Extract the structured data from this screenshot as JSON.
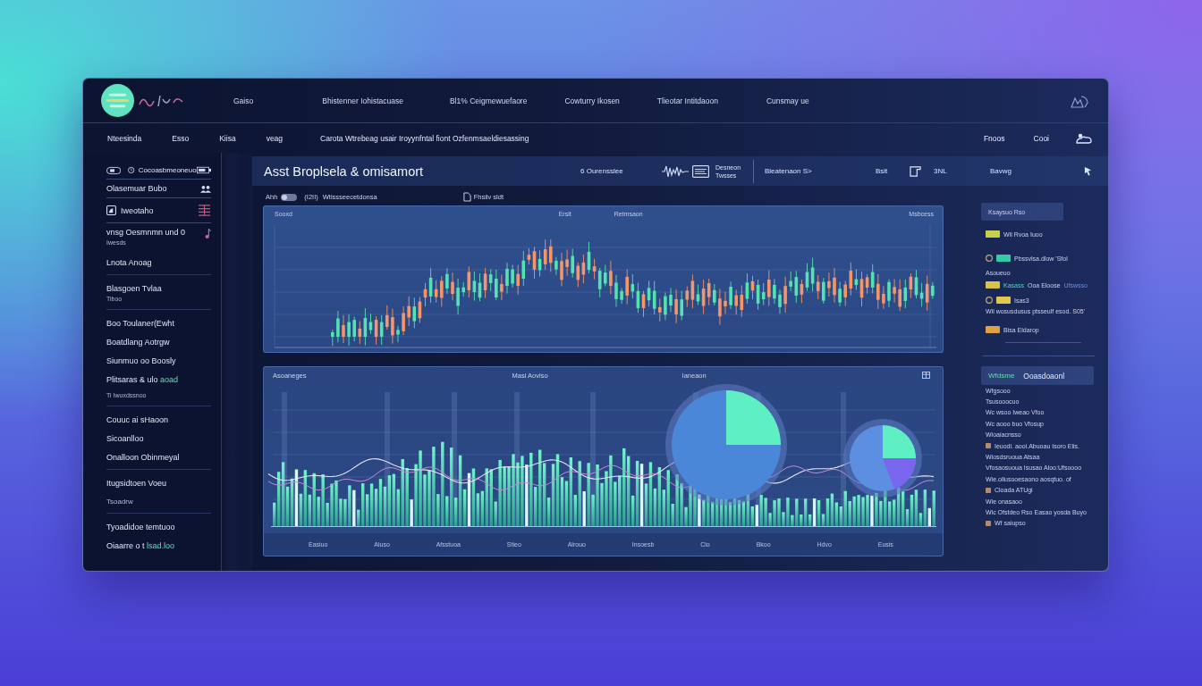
{
  "nav": [
    "Gaiso",
    "Bhistenner Iohistacuase",
    "Bl1% Ceigmewuefaore",
    "Cowturry Ikosen",
    "Tlieotar Intitdaoon",
    "Cunsmay ue"
  ],
  "subnav": [
    "Nteesinda",
    "Esso",
    "Kiisa",
    "veag"
  ],
  "headline": "Carota Wtrebeag usair Iroyynfntal fiont Ozfenmsaeldiesassing",
  "actions": [
    "Fnoos",
    "Cooi"
  ],
  "sidebar": {
    "search_label": "Cocoasbmeoneuo",
    "rows": [
      {
        "label": "Olasemuar Bubo"
      },
      {
        "label": "Iweotaho"
      },
      {
        "label": "vnsg Oesmnmn und 0",
        "sublabel": "Iwesds"
      }
    ],
    "sections": [
      {
        "items": [
          {
            "label": "Lnota Anoag"
          }
        ]
      },
      {
        "items": [
          {
            "label": "Blasgoen Tvlaa",
            "sublabel": "Tiboo"
          }
        ]
      },
      {
        "items": [
          {
            "label": "Boo Toulaner(Ewht"
          },
          {
            "label": "Boatdlang Aotrgw"
          },
          {
            "label": "Siunmuo oo Boosly"
          },
          {
            "label": "Plitsaras & ulo",
            "accent": "aoad",
            "sublabel": "Ti Iwuxdssnoo"
          }
        ]
      },
      {
        "items": [
          {
            "label": "Couuc ai sHaoon"
          },
          {
            "label": "Sicoanlloo"
          },
          {
            "label": "Onalloon Obinmeyal"
          }
        ]
      },
      {
        "items": [
          {
            "label": "Itugsidtoen Voeu",
            "sublabel": "Tsoadrw"
          }
        ]
      },
      {
        "items": [
          {
            "label": "Tyoadidoe temtuoo"
          },
          {
            "label": "Oiaarre o t",
            "accent": "lsad.loo"
          }
        ]
      }
    ]
  },
  "dashboard": {
    "title": "Asst Broplsela & omisamort",
    "filter": "6 Ourensslee",
    "legend": [
      "Desneon",
      "Twsses"
    ],
    "range": "Bleatenaon S>",
    "mode": "Bsit",
    "unit": "3NL",
    "user": "Bavwg",
    "toggle": {
      "label": "Ahh",
      "on": false
    },
    "count": "(I2II)",
    "segment": "Wtissseecetdonsa",
    "link": "Fhsilv sldt"
  },
  "price_panel": {
    "labels": [
      "Sooxd",
      "Ersit",
      "Retmsaon",
      "Msbcess"
    ]
  },
  "volume_panel": {
    "labels": [
      "Asoaneges",
      "Masi Aoviso",
      "Ianeaon"
    ],
    "x_labels": [
      "Easiuo",
      "Aluso",
      "Afsstuoa",
      "Stieo",
      "Alrouo",
      "Insoesb",
      "Cio",
      "Bkoo",
      "Hdvo",
      "Eusis"
    ]
  },
  "summary": {
    "title": "Ksaysuo Rso",
    "rows": [
      {
        "kind": "tag",
        "color": "#c8cf4c",
        "label": "Wil Rvoa Iuoo"
      },
      {
        "kind": "pair",
        "color": "#35c9a6",
        "label": "Pbssvlsa.dlow 'Sfol",
        "note": "Asoueuo"
      },
      {
        "kind": "tag",
        "color": "#d9c24a",
        "accent": "Kasass",
        "label": "Ooa Eloose",
        "trail": "Ufswsso"
      },
      {
        "kind": "pair",
        "color": "#e3c64e",
        "label": "Isas3",
        "note": "Wil wosusdusus ptsseulf esod. S05'"
      },
      {
        "kind": "tag",
        "color": "#e0a13f",
        "label": "Bisa Eldarop"
      }
    ]
  },
  "details": {
    "title_accent": "Wfdsme",
    "title": "Ooasdoaonl",
    "lines": [
      {
        "kind": "text",
        "text": "Wfgsooo"
      },
      {
        "kind": "text",
        "text": "Tsusooocuo"
      },
      {
        "kind": "text",
        "text": "Wc wsoo Iweao Vfoo"
      },
      {
        "kind": "text",
        "text": "Wc aooo buo Vfosup"
      },
      {
        "kind": "text",
        "text": "Wioaiacnsso"
      },
      {
        "kind": "bullet",
        "text": "Ieuodi. aooi.Abuoau Isoro Elis."
      },
      {
        "kind": "text",
        "text": "Wiosdsruoua Atsaa"
      },
      {
        "kind": "text",
        "text": "Vfosaosuoua Isusao Aloo:Ufsoooo"
      },
      {
        "kind": "text",
        "text": "Wie.oliusooesaono aosqtuo. of"
      },
      {
        "kind": "bullet",
        "text": "Cloada ATUgi"
      },
      {
        "kind": "text",
        "text": "Wie onasaoo"
      },
      {
        "kind": "text",
        "text": "Wic Ofstdeo Rso Easao yosda Buyo"
      },
      {
        "kind": "bullet",
        "text": "Wf saiupso"
      }
    ]
  }
}
